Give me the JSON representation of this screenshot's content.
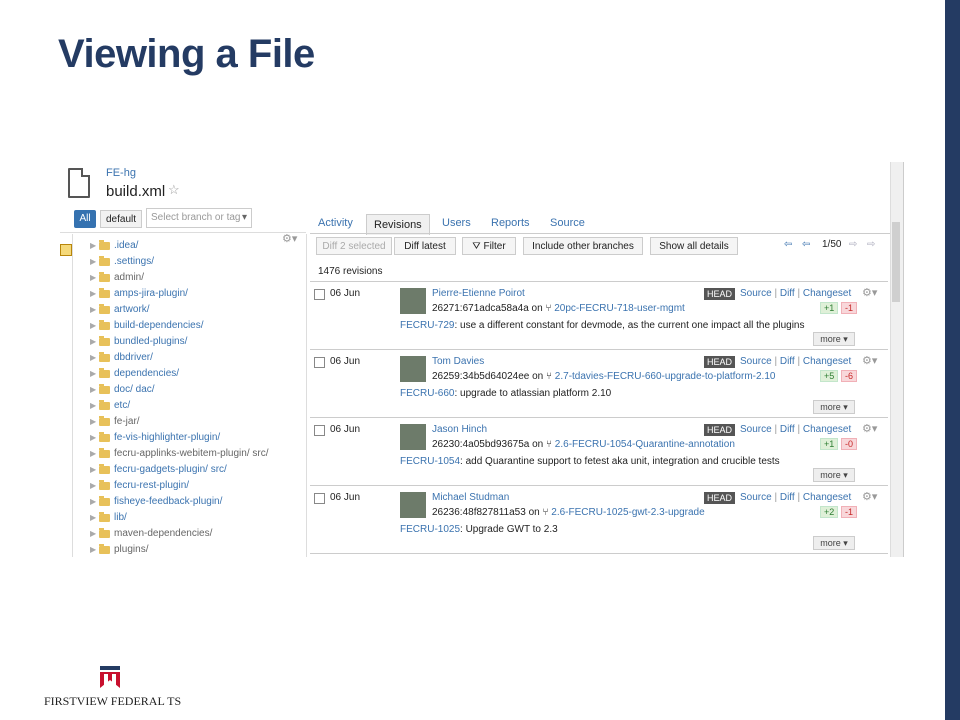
{
  "slide": {
    "title": "Viewing a File"
  },
  "file": {
    "repo": "FE-hg",
    "name": "build.xml"
  },
  "filters": {
    "all_label": "All",
    "default_label": "default",
    "branch_placeholder": "Select branch or tag"
  },
  "tree": [
    {
      "label": ".idea/",
      "muted": false
    },
    {
      "label": ".settings/",
      "muted": false
    },
    {
      "label": "admin/",
      "muted": true
    },
    {
      "label": "amps-jira-plugin/",
      "muted": false
    },
    {
      "label": "artwork/",
      "muted": false
    },
    {
      "label": "build-dependencies/",
      "muted": false
    },
    {
      "label": "bundled-plugins/",
      "muted": false
    },
    {
      "label": "dbdriver/",
      "muted": false
    },
    {
      "label": "dependencies/",
      "muted": false
    },
    {
      "label": "doc/ dac/",
      "muted": false
    },
    {
      "label": "etc/",
      "muted": false
    },
    {
      "label": "fe-jar/",
      "muted": true
    },
    {
      "label": "fe-vis-highlighter-plugin/",
      "muted": false
    },
    {
      "label": "fecru-applinks-webitem-plugin/ src/",
      "muted": true
    },
    {
      "label": "fecru-gadgets-plugin/ src/",
      "muted": false
    },
    {
      "label": "fecru-rest-plugin/",
      "muted": false
    },
    {
      "label": "fisheye-feedback-plugin/",
      "muted": false
    },
    {
      "label": "lib/",
      "muted": false
    },
    {
      "label": "maven-dependencies/",
      "muted": true
    },
    {
      "label": "plugins/",
      "muted": true
    }
  ],
  "tabs": [
    "Activity",
    "Revisions",
    "Users",
    "Reports",
    "Source"
  ],
  "toolbar": {
    "diff_selected": "Diff 2 selected",
    "diff_latest": "Diff latest",
    "filter": "Filter",
    "include_branches": "Include other branches",
    "show_all": "Show all details",
    "pager": "1/50"
  },
  "revision_count": "1476 revisions",
  "revision_labels": {
    "on": "on",
    "head": "HEAD",
    "source": "Source",
    "diff": "Diff",
    "changeset": "Changeset",
    "more": "more"
  },
  "revisions": [
    {
      "date": "06 Jun",
      "author": "Pierre-Etienne Poirot",
      "hash": "26271:671adca58a4a",
      "branch": "20pc-FECRU-718-user-mgmt",
      "key": "FECRU-729",
      "message": ": use a different constant for devmode, as the current one impact all the plugins",
      "added": "+1",
      "removed": "-1"
    },
    {
      "date": "06 Jun",
      "author": "Tom Davies",
      "hash": "26259:34b5d64024ee",
      "branch": "2.7-tdavies-FECRU-660-upgrade-to-platform-2.10",
      "key": "FECRU-660",
      "message": ": upgrade to atlassian platform 2.10",
      "added": "+5",
      "removed": "-6"
    },
    {
      "date": "06 Jun",
      "author": "Jason Hinch",
      "hash": "26230:4a05bd93675a",
      "branch": "2.6-FECRU-1054-Quarantine-annotation",
      "key": "FECRU-1054",
      "message": ": add Quarantine support to fetest aka unit, integration and crucible tests",
      "added": "+1",
      "removed": "-0"
    },
    {
      "date": "06 Jun",
      "author": "Michael Studman",
      "hash": "26236:48f827811a53",
      "branch": "2.6-FECRU-1025-gwt-2.3-upgrade",
      "key": "FECRU-1025",
      "message": ": Upgrade GWT to 2.3",
      "added": "+2",
      "removed": "-1"
    }
  ],
  "logo": {
    "text": "FIRSTVIEW FEDERAL TS"
  },
  "colors": {
    "brand": "#243b63",
    "link": "#3b73af",
    "logo_red": "#c8102e"
  }
}
